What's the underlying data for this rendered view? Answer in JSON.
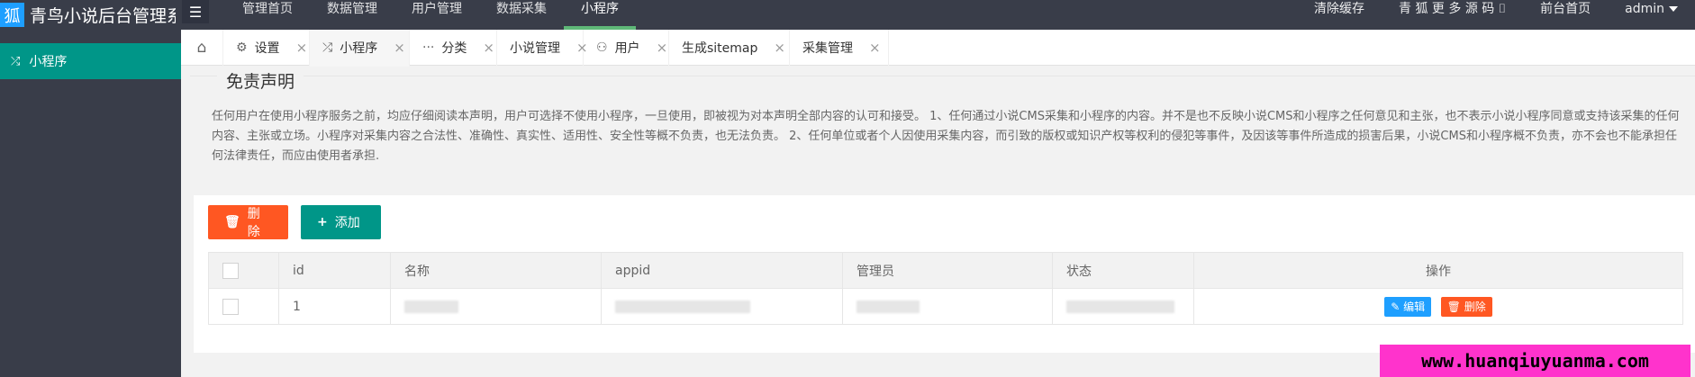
{
  "header": {
    "logo_text": "狐",
    "title": "青鸟小说后台管理系",
    "menu_icon": "☰",
    "nav": [
      "管理首页",
      "数据管理",
      "用户管理",
      "数据采集",
      "小程序"
    ],
    "right": [
      "清除缓存",
      "青 狐 更 多 源 码 ⌷",
      "前台首页",
      "admin"
    ]
  },
  "sidebar": {
    "items": [
      {
        "icon": "⤮",
        "label": "小程序"
      }
    ]
  },
  "tabs": [
    {
      "icon": "⌂",
      "label": "",
      "close": ""
    },
    {
      "icon": "⚙",
      "label": "设置",
      "close": "×"
    },
    {
      "icon": "⤮",
      "label": "小程序",
      "close": "×"
    },
    {
      "icon": "···",
      "label": "分类",
      "close": "×"
    },
    {
      "icon": "",
      "label": "小说管理",
      "close": "×"
    },
    {
      "icon": "⚇",
      "label": "用户",
      "close": "×"
    },
    {
      "icon": "",
      "label": "生成sitemap",
      "close": "×"
    },
    {
      "icon": "",
      "label": "采集管理",
      "close": "×"
    }
  ],
  "disclaimer": {
    "title": "免责声明",
    "text": "任何用户在使用小程序服务之前，均应仔细阅读本声明，用户可选择不使用小程序，一旦使用，即被视为对本声明全部内容的认可和接受。 1、任何通过小说CMS采集和小程序的内容。并不是也不反映小说CMS和小程序之任何意见和主张，也不表示小说小程序同意或支持该采集的任何内容、主张或立场。小程序对采集内容之合法性、准确性、真实性、适用性、安全性等概不负责，也无法负责。 2、任何单位或者个人因使用采集内容，而引致的版权或知识产权等权利的侵犯等事件，及因该等事件所造成的损害后果，小说CMS和小程序概不负责，亦不会也不能承担任何法律责任，而应由使用者承担."
  },
  "toolbar": {
    "delete_label": "删除",
    "delete_icon": "🗑",
    "add_label": "添加",
    "add_icon": "+"
  },
  "table": {
    "headers": [
      "id",
      "名称",
      "appid",
      "管理员",
      "状态",
      "操作"
    ],
    "rows": [
      {
        "id": "1",
        "edit": "编辑",
        "edit_icon": "✎",
        "delete": "删除",
        "delete_icon": "🗑"
      }
    ]
  },
  "watermark": "www.huanqiuyuanma.com",
  "colors": {
    "header": "#393d49",
    "accent": "#009688",
    "danger": "#ff5722",
    "primary": "#1e9fff",
    "watermark": "#ff33cc"
  }
}
